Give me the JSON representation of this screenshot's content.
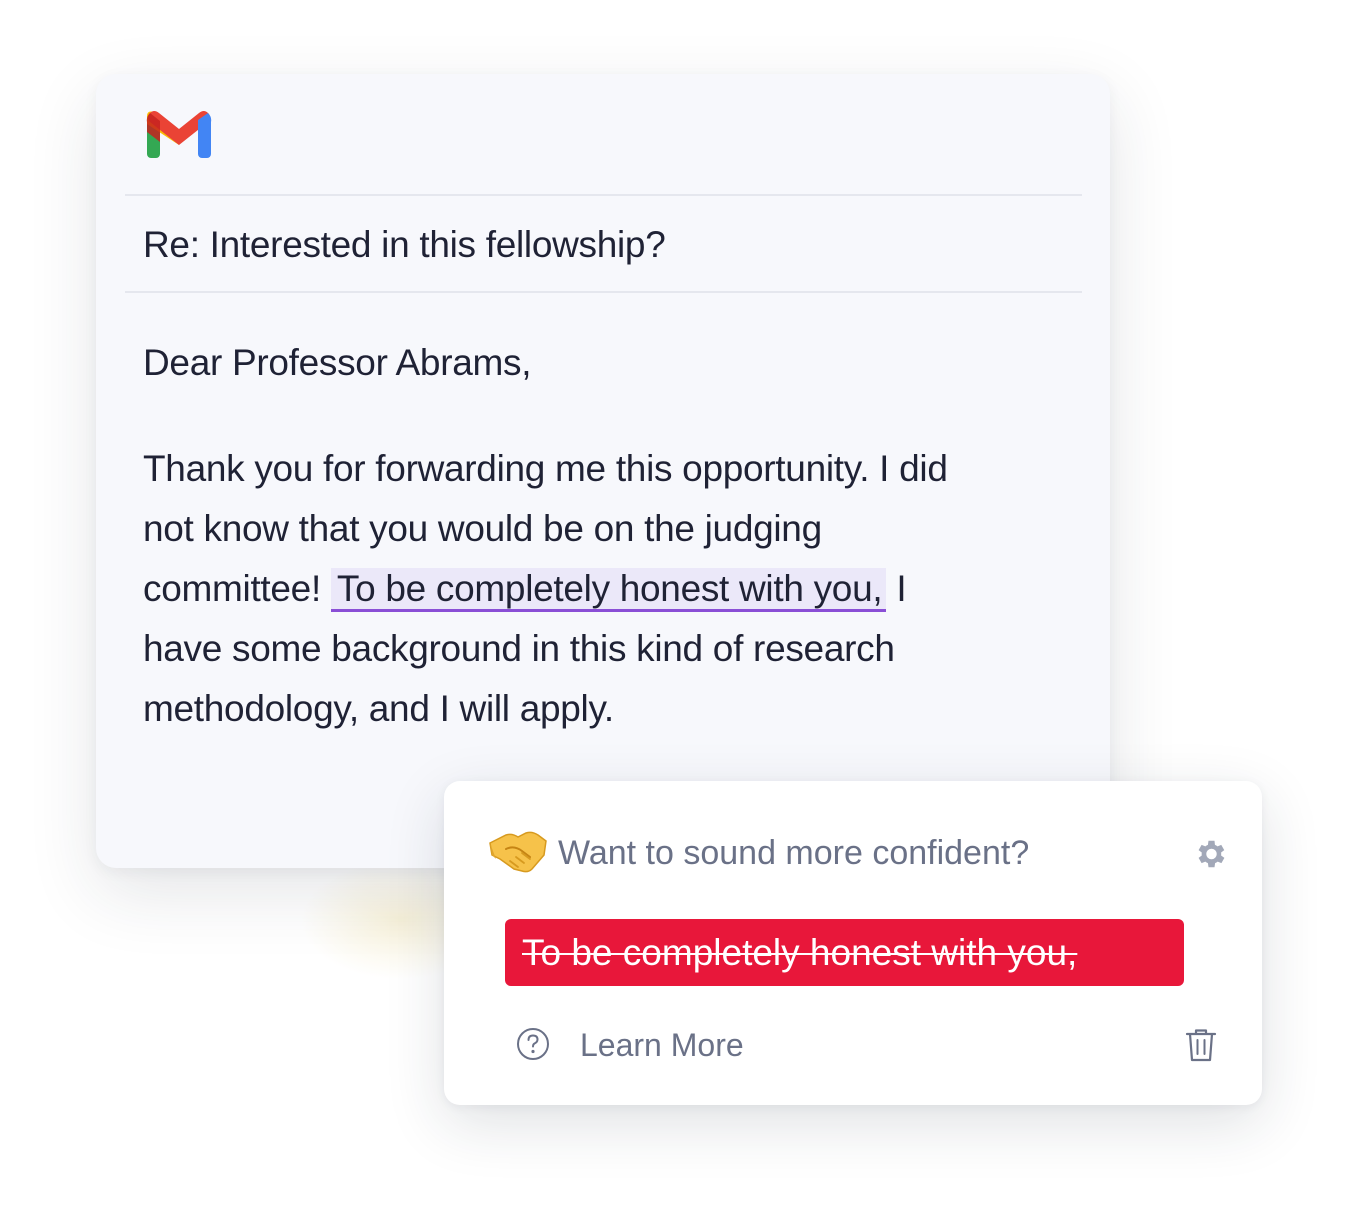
{
  "email": {
    "app_icon": "gmail-logo",
    "subject": "Re: Interested in this fellowship?",
    "greeting": "Dear Professor Abrams,",
    "body_lines": {
      "line1": "Thank you for forwarding me this opportunity. I did",
      "line2": "not know that you would be on the judging",
      "line3_before": "committee!",
      "line3_highlight": "To be completely honest with you,",
      "line3_after": " I",
      "line4": "have some background in this kind of research",
      "line5": "methodology, and I will apply."
    }
  },
  "suggestion_popup": {
    "icon": "handshake-icon",
    "title": "Want to sound more confident?",
    "settings_icon": "gear-icon",
    "removed_text": "To be completely honest with you,",
    "help_icon": "question-circle-icon",
    "learn_more_label": "Learn More",
    "dismiss_icon": "trash-icon"
  },
  "colors": {
    "highlight_bg": "#ebe8f9",
    "highlight_underline": "#8a4fd6",
    "suggestion_bg": "#e8173a",
    "text": "#1f2235",
    "muted": "#6a7187"
  }
}
